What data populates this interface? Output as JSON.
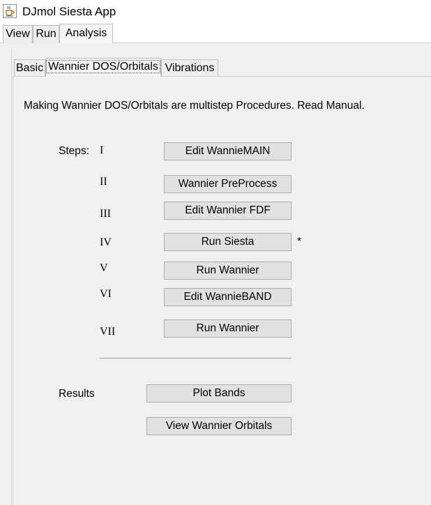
{
  "window": {
    "title": "DJmol Siesta App",
    "icon": "java-cup-icon"
  },
  "menu_tabs": [
    "View",
    "Run",
    "Analysis"
  ],
  "active_menu_tab": "Analysis",
  "sub_tabs": [
    "Basic",
    "Wannier DOS/Orbitals",
    "Vibrations"
  ],
  "active_sub_tab": "Wannier DOS/Orbitals",
  "intro_text": "Making Wannier DOS/Orbitals are multistep Procedures. Read Manual.",
  "steps_label": "Steps:",
  "steps": [
    {
      "numeral": "I",
      "button": "Edit WannieMAIN"
    },
    {
      "numeral": "II",
      "button": "Wannier PreProcess"
    },
    {
      "numeral": "III",
      "button": "Edit Wannier FDF"
    },
    {
      "numeral": "IV",
      "button": "Run Siesta",
      "marker": "*"
    },
    {
      "numeral": "V",
      "button": "Run Wannier"
    },
    {
      "numeral": "VI",
      "button": "Edit WannieBAND"
    },
    {
      "numeral": "VII",
      "button": "Run Wannier"
    }
  ],
  "results_label": "Results",
  "results_buttons": [
    "Plot Bands",
    "View Wannier Orbitals"
  ]
}
